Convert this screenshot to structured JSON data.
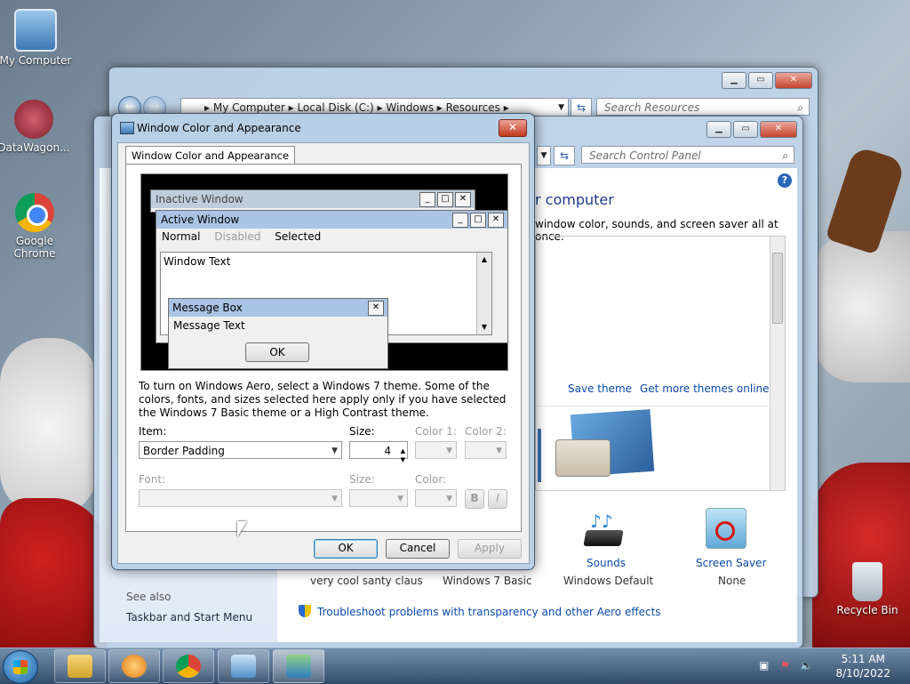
{
  "desktop": {
    "icons": [
      {
        "label": "My Computer",
        "icon": "computer-icon"
      },
      {
        "label": "DataWagon...",
        "icon": "datawagon-icon"
      },
      {
        "label": "Google Chrome",
        "icon": "chrome-icon"
      },
      {
        "label": "Recycle Bin",
        "icon": "recycle-bin-icon"
      }
    ]
  },
  "explorer": {
    "breadcrumb": [
      "My Computer",
      "Local Disk (C:)",
      "Windows",
      "Resources"
    ],
    "search_placeholder": "Search Resources"
  },
  "control_panel": {
    "search_placeholder": "Search Control Panel",
    "heading_fragment": "r computer",
    "subheading_fragment": "window color, sounds, and screen saver all at once.",
    "save_theme": "Save theme",
    "get_more_themes": "Get more themes online",
    "sounds_label": "Sounds",
    "sounds_value": "Windows Default",
    "screensaver_label": "Screen Saver",
    "screensaver_value": "None",
    "theme1_label": "very cool santy claus",
    "theme2_label": "Windows 7 Basic",
    "see_also": "See also",
    "taskbar_link": "Taskbar and Start Menu",
    "troubleshoot_link": "Troubleshoot problems with transparency and other Aero effects"
  },
  "dialog": {
    "title": "Window Color and Appearance",
    "tab": "Window Color and Appearance",
    "preview": {
      "inactive_title": "Inactive Window",
      "active_title": "Active Window",
      "menu_normal": "Normal",
      "menu_disabled": "Disabled",
      "menu_selected": "Selected",
      "window_text": "Window Text",
      "msgbox_title": "Message Box",
      "msgbox_text": "Message Text",
      "msgbox_ok": "OK"
    },
    "description": "To turn on Windows Aero, select a Windows 7 theme.  Some of the colors, fonts, and sizes selected here apply only if you have selected the Windows 7 Basic theme or a High Contrast theme.",
    "item_label": "Item:",
    "item_value": "Border Padding",
    "size_label": "Size:",
    "size_value": "4",
    "color1_label": "Color 1:",
    "color2_label": "Color 2:",
    "font_label": "Font:",
    "font_size_label": "Size:",
    "font_color_label": "Color:",
    "bold": "B",
    "italic": "I",
    "ok": "OK",
    "cancel": "Cancel",
    "apply": "Apply"
  },
  "taskbar": {
    "time": "5:11 AM",
    "date": "8/10/2022"
  },
  "colors": {
    "link": "#0a4aa6",
    "taskbar_top": "#6e8caa",
    "taskbar_bottom": "#2d4664"
  }
}
